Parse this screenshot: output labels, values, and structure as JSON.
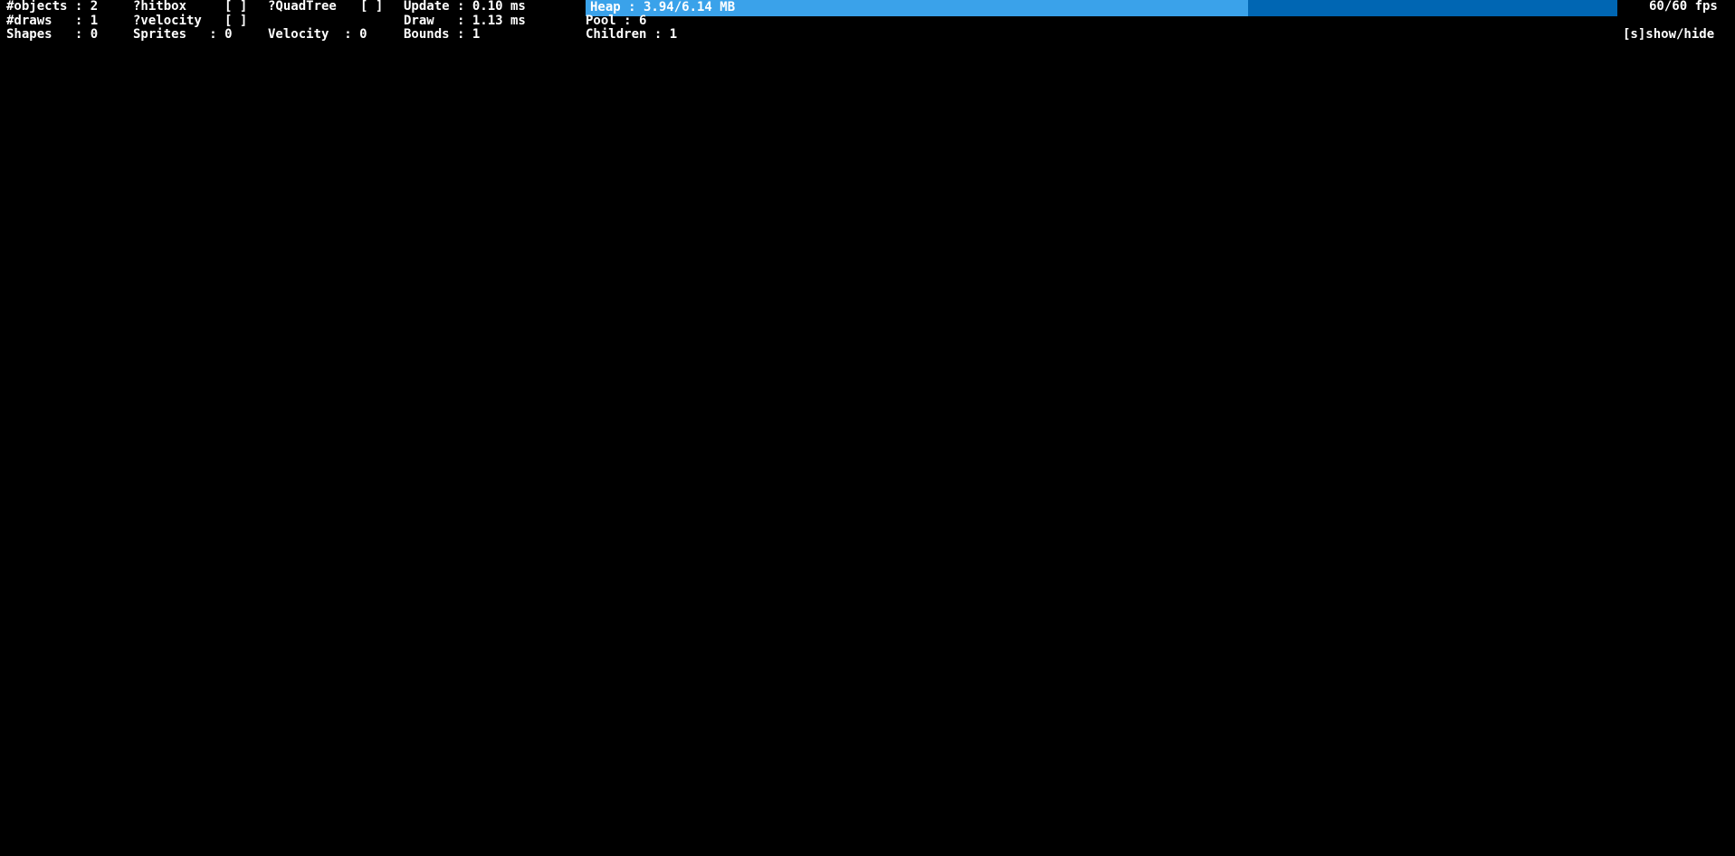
{
  "debug_panel": {
    "row1": {
      "objects": "#objects : 2",
      "hitbox_label": "?hitbox",
      "hitbox_checkbox": "[ ]",
      "quadtree_label": "?QuadTree",
      "quadtree_checkbox": "[ ]",
      "update": "Update : 0.10 ms"
    },
    "row2": {
      "draws": "#draws   : 1",
      "velocity_label": "?velocity",
      "velocity_checkbox": "[ ]",
      "draw": "Draw   : 1.13 ms",
      "pool": "Pool : 6"
    },
    "row3": {
      "shapes": "Shapes   : 0",
      "sprites": "Sprites   : 0",
      "velocity_count": "Velocity  : 0",
      "bounds": "Bounds : 1",
      "children": "Children : 1"
    },
    "heap": {
      "label": "Heap : 3.94/6.14 MB",
      "used_fraction": 0.642,
      "fill_color": "#3aa2ea",
      "bar_color": "#0066b3"
    },
    "fps": "60/60 fps",
    "toggle": "[s]show/hide"
  }
}
